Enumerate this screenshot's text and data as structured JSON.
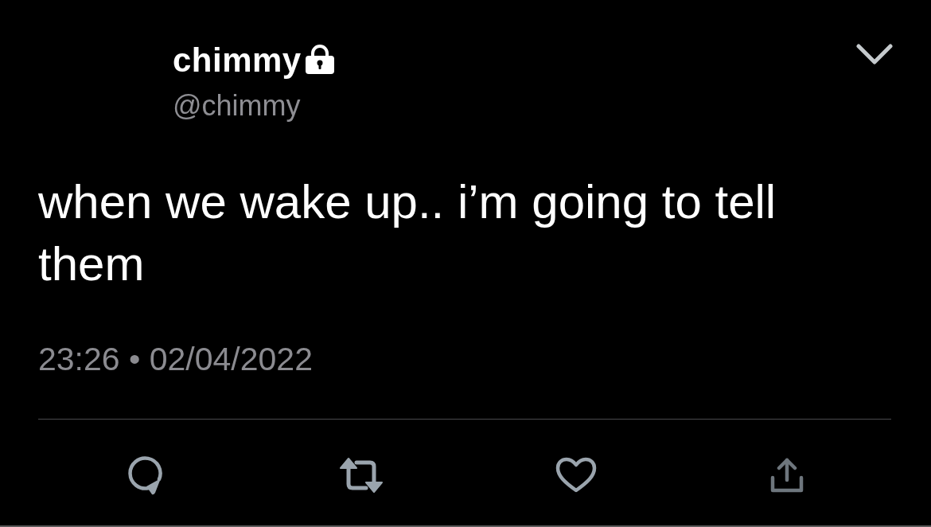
{
  "header": {
    "display_name": "chimmy",
    "protected": true,
    "handle": "@chimmy"
  },
  "tweet": {
    "text": "when we wake up.. i’m going to tell them",
    "timestamp": "23:26 • 02/04/2022"
  },
  "actions": [
    {
      "kind": "reply"
    },
    {
      "kind": "retweet"
    },
    {
      "kind": "like"
    },
    {
      "kind": "share"
    }
  ]
}
